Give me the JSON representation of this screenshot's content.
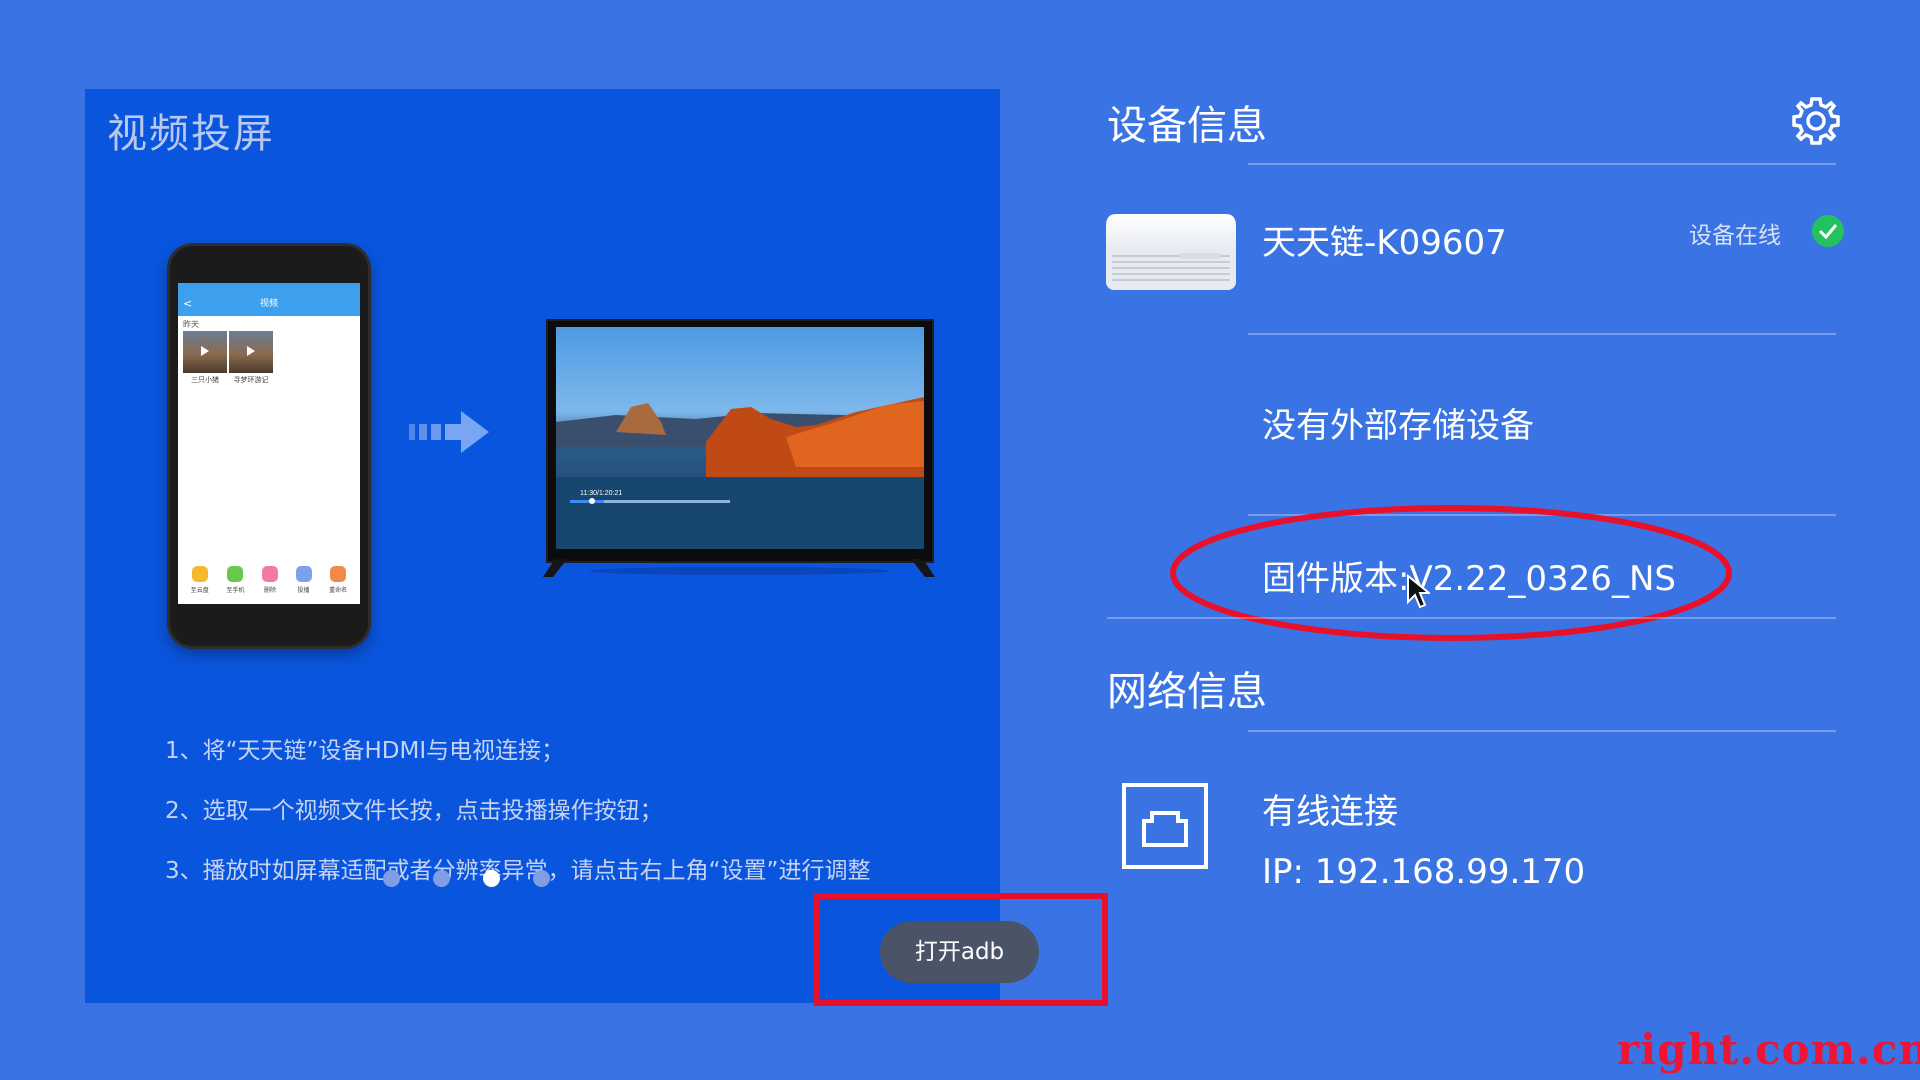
{
  "left_card": {
    "title": "视频投屏",
    "phone": {
      "header_title": "视频",
      "back_glyph": "<",
      "date_label": "昨天",
      "thumbs": [
        {
          "caption": "三只小猪"
        },
        {
          "caption": "寻梦环游记"
        }
      ],
      "tools": [
        {
          "label": "至云盘",
          "color": "#f5b82e"
        },
        {
          "label": "至手机",
          "color": "#67c84b"
        },
        {
          "label": "删除",
          "color": "#f07aa3"
        },
        {
          "label": "投播",
          "color": "#7aa0f0"
        },
        {
          "label": "重命名",
          "color": "#f08a4a"
        }
      ]
    },
    "tv": {
      "timestamp": "11:30/1:20:21"
    },
    "steps": [
      "1、将“天天链”设备HDMI与电视连接；",
      "2、选取一个视频文件长按，点击投播操作按钮；",
      "3、播放时如屏幕适配或者分辨率异常，请点击右上角“设置”进行调整"
    ],
    "pagination": {
      "count": 4,
      "active_index": 2
    }
  },
  "adb_button": {
    "label": "打开adb"
  },
  "device_info": {
    "title": "设备信息",
    "device_name": "天天链-K09607",
    "status": "设备在线",
    "storage": "没有外部存储设备",
    "firmware": "固件版本:V2.22_0326_NS"
  },
  "network_info": {
    "title": "网络信息",
    "type": "有线连接",
    "ip": "IP: 192.168.99.170"
  },
  "watermark": "right.com.cn",
  "colors": {
    "background": "#3a73e3",
    "card": "#0a55de",
    "highlight": "#e8102a",
    "online": "#22c35e"
  }
}
